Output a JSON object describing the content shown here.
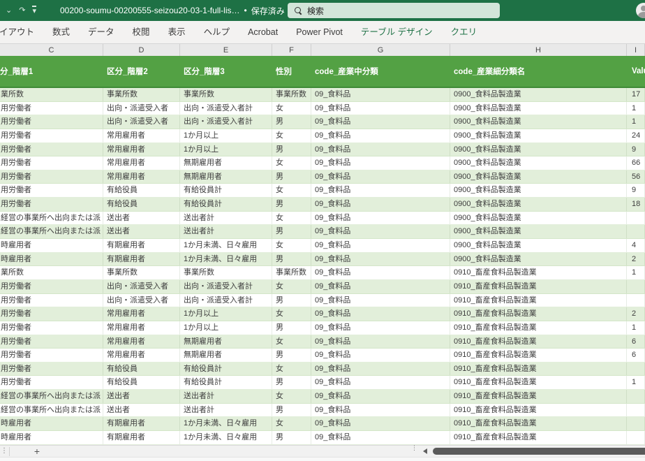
{
  "titlebar": {
    "title": "00200-soumu-00200555-seizou20-03-1-full-lis…",
    "separator": "•",
    "saved_status": "保存済み",
    "saved_chevron": "⌄",
    "undo_chevron": "⌄",
    "redo_glyph": "↷",
    "search_placeholder": "検索",
    "bg_color": "#1e7145"
  },
  "ribbon": {
    "tabs": [
      {
        "label": "イアウト",
        "contextual": false
      },
      {
        "label": "数式",
        "contextual": false
      },
      {
        "label": "データ",
        "contextual": false
      },
      {
        "label": "校閲",
        "contextual": false
      },
      {
        "label": "表示",
        "contextual": false
      },
      {
        "label": "ヘルプ",
        "contextual": false
      },
      {
        "label": "Acrobat",
        "contextual": false
      },
      {
        "label": "Power Pivot",
        "contextual": false
      },
      {
        "label": "テーブル デザイン",
        "contextual": true
      },
      {
        "label": "クエリ",
        "contextual": true
      }
    ],
    "contextual_color": "#1e7145"
  },
  "grid": {
    "column_letters": [
      "C",
      "D",
      "E",
      "F",
      "G",
      "H",
      "I"
    ]
  },
  "table": {
    "header_bg": "#53a144",
    "band_color": "#e2efda",
    "headers": {
      "c": "分_階層1",
      "d": "区分_階層2",
      "e": "区分_階層3",
      "f": "性別",
      "g": "code_産業中分類",
      "h": "code_産業細分類名",
      "v": "Value"
    },
    "rows": [
      {
        "c": "業所数",
        "d": "事業所数",
        "e": "事業所数",
        "f": "事業所数",
        "g": "09_食料品",
        "h": "0900_食料品製造業",
        "v": "17"
      },
      {
        "c": "用労働者",
        "d": "出向・派遣受入者",
        "e": "出向・派遣受入者計",
        "f": "女",
        "g": "09_食料品",
        "h": "0900_食料品製造業",
        "v": "1"
      },
      {
        "c": "用労働者",
        "d": "出向・派遣受入者",
        "e": "出向・派遣受入者計",
        "f": "男",
        "g": "09_食料品",
        "h": "0900_食料品製造業",
        "v": "1"
      },
      {
        "c": "用労働者",
        "d": "常用雇用者",
        "e": "1か月以上",
        "f": "女",
        "g": "09_食料品",
        "h": "0900_食料品製造業",
        "v": "24"
      },
      {
        "c": "用労働者",
        "d": "常用雇用者",
        "e": "1か月以上",
        "f": "男",
        "g": "09_食料品",
        "h": "0900_食料品製造業",
        "v": "9"
      },
      {
        "c": "用労働者",
        "d": "常用雇用者",
        "e": "無期雇用者",
        "f": "女",
        "g": "09_食料品",
        "h": "0900_食料品製造業",
        "v": "66"
      },
      {
        "c": "用労働者",
        "d": "常用雇用者",
        "e": "無期雇用者",
        "f": "男",
        "g": "09_食料品",
        "h": "0900_食料品製造業",
        "v": "56"
      },
      {
        "c": "用労働者",
        "d": "有給役員",
        "e": "有給役員計",
        "f": "女",
        "g": "09_食料品",
        "h": "0900_食料品製造業",
        "v": "9"
      },
      {
        "c": "用労働者",
        "d": "有給役員",
        "e": "有給役員計",
        "f": "男",
        "g": "09_食料品",
        "h": "0900_食料品製造業",
        "v": "18"
      },
      {
        "c": "経営の事業所へ出向または派",
        "d": "送出者",
        "e": "送出者計",
        "f": "女",
        "g": "09_食料品",
        "h": "0900_食料品製造業",
        "v": ""
      },
      {
        "c": "経営の事業所へ出向または派",
        "d": "送出者",
        "e": "送出者計",
        "f": "男",
        "g": "09_食料品",
        "h": "0900_食料品製造業",
        "v": ""
      },
      {
        "c": "時雇用者",
        "d": "有期雇用者",
        "e": "1か月未満、日々雇用",
        "f": "女",
        "g": "09_食料品",
        "h": "0900_食料品製造業",
        "v": "4"
      },
      {
        "c": "時雇用者",
        "d": "有期雇用者",
        "e": "1か月未満、日々雇用",
        "f": "男",
        "g": "09_食料品",
        "h": "0900_食料品製造業",
        "v": "2"
      },
      {
        "c": "業所数",
        "d": "事業所数",
        "e": "事業所数",
        "f": "事業所数",
        "g": "09_食料品",
        "h": "0910_畜産食料品製造業",
        "v": "1"
      },
      {
        "c": "用労働者",
        "d": "出向・派遣受入者",
        "e": "出向・派遣受入者計",
        "f": "女",
        "g": "09_食料品",
        "h": "0910_畜産食料品製造業",
        "v": ""
      },
      {
        "c": "用労働者",
        "d": "出向・派遣受入者",
        "e": "出向・派遣受入者計",
        "f": "男",
        "g": "09_食料品",
        "h": "0910_畜産食料品製造業",
        "v": ""
      },
      {
        "c": "用労働者",
        "d": "常用雇用者",
        "e": "1か月以上",
        "f": "女",
        "g": "09_食料品",
        "h": "0910_畜産食料品製造業",
        "v": "2"
      },
      {
        "c": "用労働者",
        "d": "常用雇用者",
        "e": "1か月以上",
        "f": "男",
        "g": "09_食料品",
        "h": "0910_畜産食料品製造業",
        "v": "1"
      },
      {
        "c": "用労働者",
        "d": "常用雇用者",
        "e": "無期雇用者",
        "f": "女",
        "g": "09_食料品",
        "h": "0910_畜産食料品製造業",
        "v": "6"
      },
      {
        "c": "用労働者",
        "d": "常用雇用者",
        "e": "無期雇用者",
        "f": "男",
        "g": "09_食料品",
        "h": "0910_畜産食料品製造業",
        "v": "6"
      },
      {
        "c": "用労働者",
        "d": "有給役員",
        "e": "有給役員計",
        "f": "女",
        "g": "09_食料品",
        "h": "0910_畜産食料品製造業",
        "v": ""
      },
      {
        "c": "用労働者",
        "d": "有給役員",
        "e": "有給役員計",
        "f": "男",
        "g": "09_食料品",
        "h": "0910_畜産食料品製造業",
        "v": "1"
      },
      {
        "c": "経営の事業所へ出向または派",
        "d": "送出者",
        "e": "送出者計",
        "f": "女",
        "g": "09_食料品",
        "h": "0910_畜産食料品製造業",
        "v": ""
      },
      {
        "c": "経営の事業所へ出向または派",
        "d": "送出者",
        "e": "送出者計",
        "f": "男",
        "g": "09_食料品",
        "h": "0910_畜産食料品製造業",
        "v": ""
      },
      {
        "c": "時雇用者",
        "d": "有期雇用者",
        "e": "1か月未満、日々雇用",
        "f": "女",
        "g": "09_食料品",
        "h": "0910_畜産食料品製造業",
        "v": ""
      },
      {
        "c": "時雇用者",
        "d": "有期雇用者",
        "e": "1か月未満、日々雇用",
        "f": "男",
        "g": "09_食料品",
        "h": "0910_畜産食料品製造業",
        "v": ""
      }
    ]
  },
  "sheetbar": {
    "add_sheet_label": "+"
  }
}
